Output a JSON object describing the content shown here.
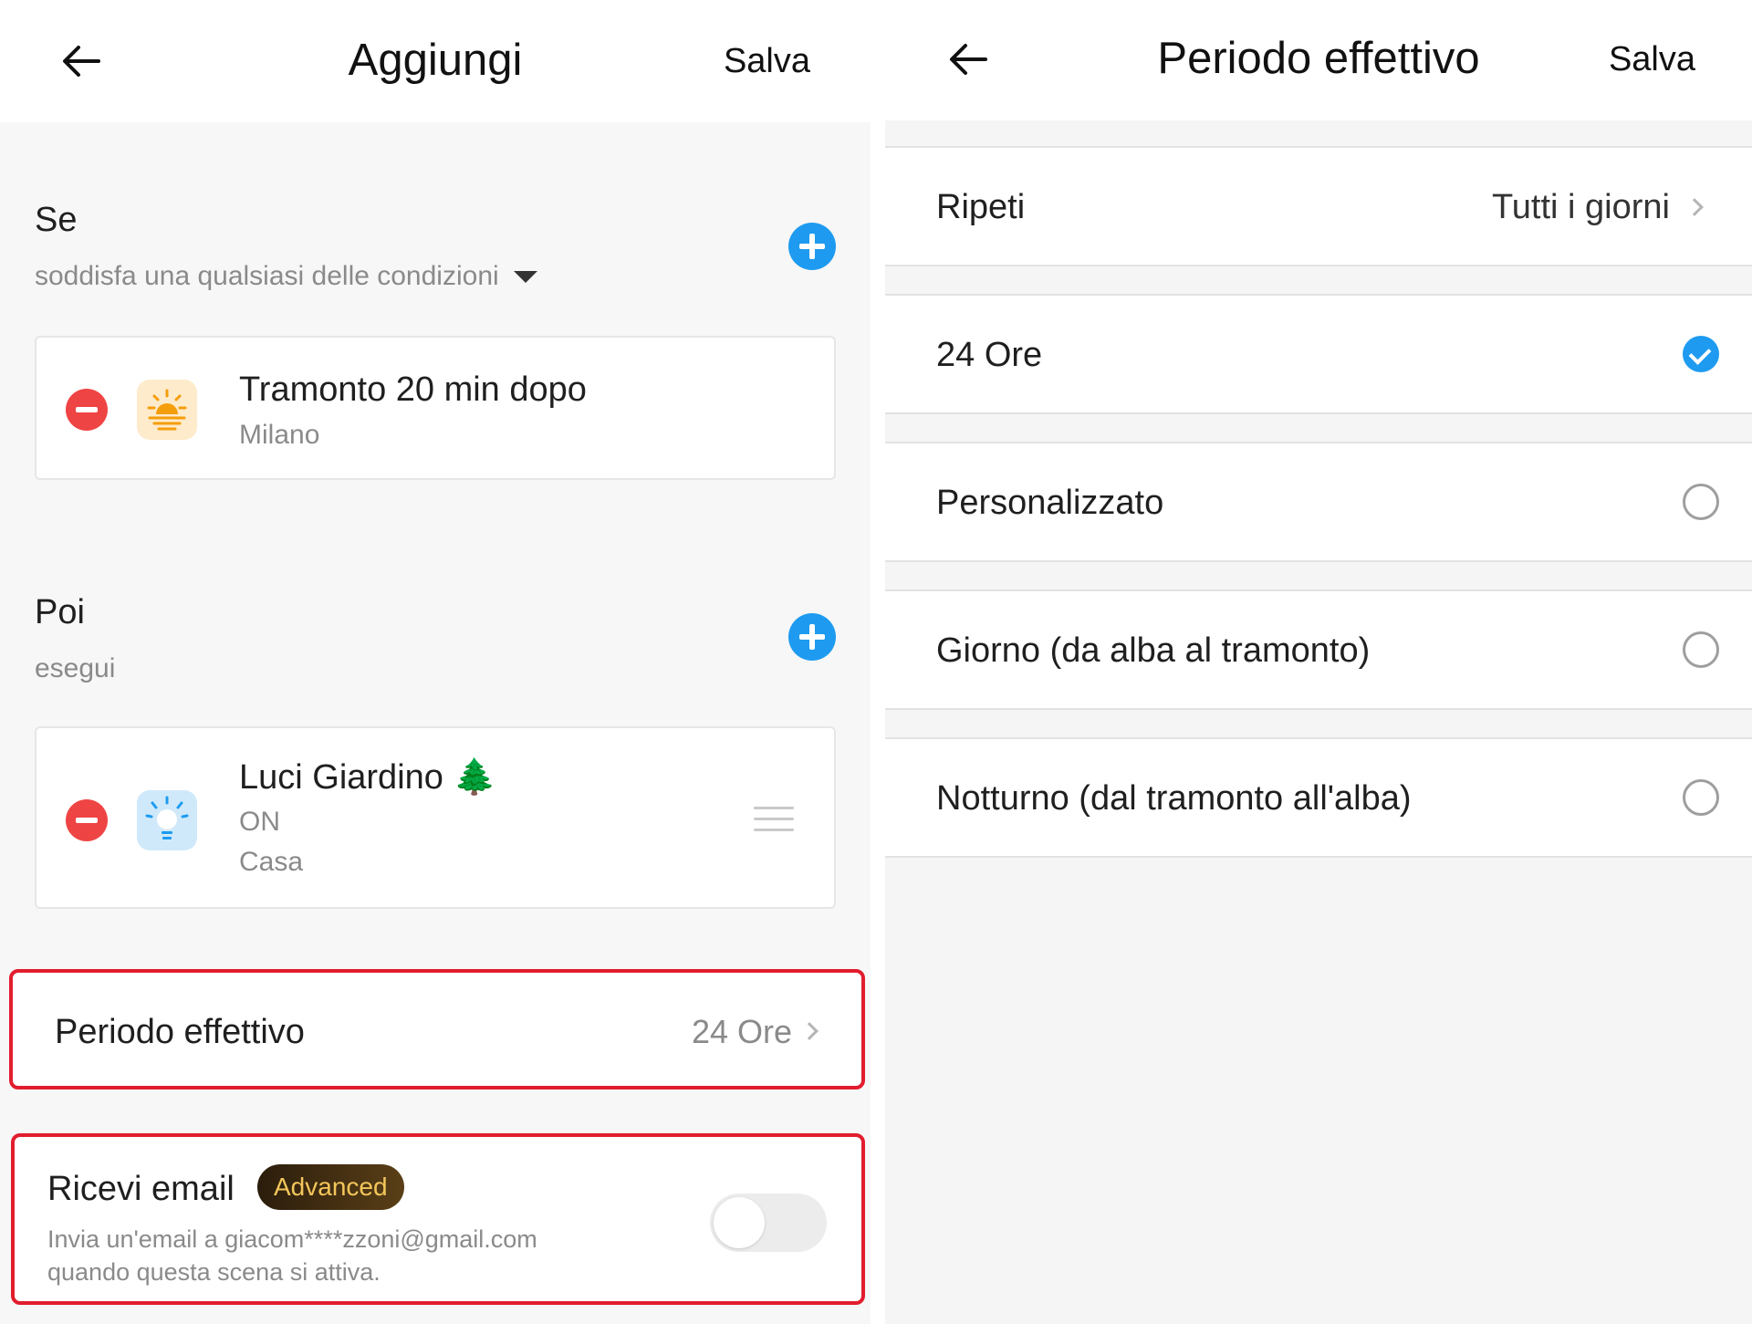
{
  "left": {
    "header": {
      "title": "Aggiungi",
      "save_label": "Salva"
    },
    "if_section": {
      "title": "Se",
      "subtitle": "soddisfa una qualsiasi delle condizioni",
      "condition": {
        "title": "Tramonto  20 min dopo",
        "subtitle": "Milano"
      }
    },
    "then_section": {
      "title": "Poi",
      "subtitle": "esegui",
      "action": {
        "title": "Luci Giardino",
        "emoji": "🌲",
        "state": "ON",
        "location": "Casa"
      }
    },
    "period": {
      "label": "Periodo effettivo",
      "value": "24 Ore"
    },
    "email": {
      "label": "Ricevi email",
      "badge": "Advanced",
      "description_line1": "Invia un'email a giacom****zzoni@gmail.com",
      "description_line2": "quando questa scena si attiva.",
      "enabled": false
    }
  },
  "right": {
    "header": {
      "title": "Periodo effettivo",
      "save_label": "Salva"
    },
    "repeat": {
      "label": "Ripeti",
      "value": "Tutti i giorni"
    },
    "options": [
      {
        "label": "24 Ore",
        "selected": true
      },
      {
        "label": "Personalizzato",
        "selected": false
      },
      {
        "label": "Giorno (da alba al tramonto)",
        "selected": false
      },
      {
        "label": "Notturno (dal tramonto all'alba)",
        "selected": false
      }
    ]
  },
  "colors": {
    "accent": "#1e9bf0",
    "remove": "#ef4444",
    "highlight": "#e11d2e",
    "badge_text": "#f3c65a"
  }
}
